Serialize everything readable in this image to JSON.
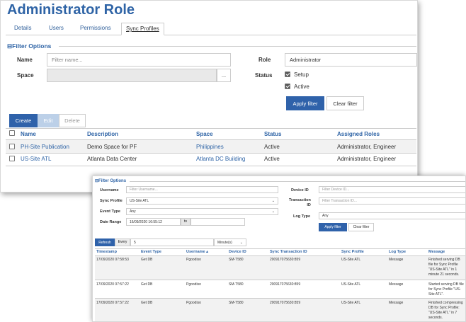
{
  "s1": {
    "title": "Administrator Role",
    "tabs": [
      "Details",
      "Users",
      "Permissions",
      "Sync Profiles"
    ],
    "filter_title": "Filter Options",
    "filter": {
      "name_label": "Name",
      "name_placeholder": "Filter name...",
      "role_label": "Role",
      "role_value": "Administrator",
      "space_label": "Space",
      "space_btn": "...",
      "status_label": "Status",
      "status_setup": "Setup",
      "status_active": "Active"
    },
    "apply": "Apply filter",
    "clear": "Clear filter",
    "toolbar": {
      "create": "Create",
      "edit": "Edit",
      "delete": "Delete"
    },
    "columns": [
      "Name",
      "Description",
      "Space",
      "Status",
      "Assigned Roles"
    ],
    "rows": [
      {
        "name": "PH-Site Publication",
        "desc": "Demo Space for PF",
        "space": "Philippines",
        "status": "Active",
        "roles": "Administrator, Engineer"
      },
      {
        "name": "US-Site ATL",
        "desc": "Atlanta Data Center",
        "space": "Atlanta DC Building",
        "status": "Active",
        "roles": "Administrator, Engineer"
      }
    ]
  },
  "s2": {
    "filter_title": "Filter Options",
    "username_label": "Username",
    "username_ph": "Filter Username...",
    "sync_label": "Sync Profile",
    "sync_value": "US-Site ATL",
    "event_label": "Event Type",
    "event_value": "Any",
    "date_label": "Date Range",
    "date_value": "16/09/2020 16:55:12",
    "date_to": "to",
    "device_label": "Device ID",
    "device_ph": "Filter Device ID...",
    "trans_label1": "Transaction",
    "trans_label2": "ID",
    "trans_ph": "Filter Transaction ID...",
    "log_label": "Log Type",
    "log_value": "Any",
    "apply": "Apply filter",
    "clear": "Clear filter",
    "refresh": "Refresh",
    "every": "Every",
    "interval": "5",
    "unit": "Minute(s)",
    "columns": [
      "Timestamp",
      "Event Type",
      "Username",
      "Device ID",
      "Sync Transaction ID",
      "Sync Profile",
      "Log Type",
      "Message"
    ],
    "rows": [
      {
        "ts": "17/09/2020 07:58:53",
        "ev": "Get DB",
        "user": "Pgoodiso",
        "dev": "SM-T580",
        "tid": "200917075630:859",
        "prof": "US-Site ATL",
        "log": "Message",
        "msg": "Finished serving DB file for Sync Profile \"US-Site ATL\" in 1 minute 21 seconds."
      },
      {
        "ts": "17/09/2020 07:57:22",
        "ev": "Get DB",
        "user": "Pgoodiso",
        "dev": "SM-T580",
        "tid": "200917075630:859",
        "prof": "US-Site ATL",
        "log": "Message",
        "msg": "Started serving DB file for Sync Profile \"US-Site ATL\"."
      },
      {
        "ts": "17/09/2020 07:57:22",
        "ev": "Get DB",
        "user": "Pgoodiso",
        "dev": "SM-T580",
        "tid": "200917075630:859",
        "prof": "US-Site ATL",
        "log": "Message",
        "msg": "Finished compressing DB for Sync Profile: \"US-Site ATL\" in 7 seconds."
      }
    ]
  },
  "colors": {
    "accent": "#2f64a6",
    "primary_button": "#2f62aa",
    "row_alt": "#f2f2f2"
  }
}
